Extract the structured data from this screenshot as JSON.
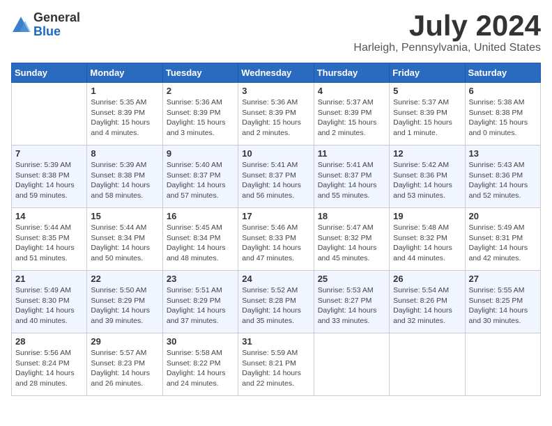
{
  "header": {
    "logo_general": "General",
    "logo_blue": "Blue",
    "month_title": "July 2024",
    "location": "Harleigh, Pennsylvania, United States"
  },
  "days_of_week": [
    "Sunday",
    "Monday",
    "Tuesday",
    "Wednesday",
    "Thursday",
    "Friday",
    "Saturday"
  ],
  "weeks": [
    [
      {
        "day": "",
        "info": ""
      },
      {
        "day": "1",
        "info": "Sunrise: 5:35 AM\nSunset: 8:39 PM\nDaylight: 15 hours\nand 4 minutes."
      },
      {
        "day": "2",
        "info": "Sunrise: 5:36 AM\nSunset: 8:39 PM\nDaylight: 15 hours\nand 3 minutes."
      },
      {
        "day": "3",
        "info": "Sunrise: 5:36 AM\nSunset: 8:39 PM\nDaylight: 15 hours\nand 2 minutes."
      },
      {
        "day": "4",
        "info": "Sunrise: 5:37 AM\nSunset: 8:39 PM\nDaylight: 15 hours\nand 2 minutes."
      },
      {
        "day": "5",
        "info": "Sunrise: 5:37 AM\nSunset: 8:39 PM\nDaylight: 15 hours\nand 1 minute."
      },
      {
        "day": "6",
        "info": "Sunrise: 5:38 AM\nSunset: 8:38 PM\nDaylight: 15 hours\nand 0 minutes."
      }
    ],
    [
      {
        "day": "7",
        "info": "Sunrise: 5:39 AM\nSunset: 8:38 PM\nDaylight: 14 hours\nand 59 minutes."
      },
      {
        "day": "8",
        "info": "Sunrise: 5:39 AM\nSunset: 8:38 PM\nDaylight: 14 hours\nand 58 minutes."
      },
      {
        "day": "9",
        "info": "Sunrise: 5:40 AM\nSunset: 8:37 PM\nDaylight: 14 hours\nand 57 minutes."
      },
      {
        "day": "10",
        "info": "Sunrise: 5:41 AM\nSunset: 8:37 PM\nDaylight: 14 hours\nand 56 minutes."
      },
      {
        "day": "11",
        "info": "Sunrise: 5:41 AM\nSunset: 8:37 PM\nDaylight: 14 hours\nand 55 minutes."
      },
      {
        "day": "12",
        "info": "Sunrise: 5:42 AM\nSunset: 8:36 PM\nDaylight: 14 hours\nand 53 minutes."
      },
      {
        "day": "13",
        "info": "Sunrise: 5:43 AM\nSunset: 8:36 PM\nDaylight: 14 hours\nand 52 minutes."
      }
    ],
    [
      {
        "day": "14",
        "info": "Sunrise: 5:44 AM\nSunset: 8:35 PM\nDaylight: 14 hours\nand 51 minutes."
      },
      {
        "day": "15",
        "info": "Sunrise: 5:44 AM\nSunset: 8:34 PM\nDaylight: 14 hours\nand 50 minutes."
      },
      {
        "day": "16",
        "info": "Sunrise: 5:45 AM\nSunset: 8:34 PM\nDaylight: 14 hours\nand 48 minutes."
      },
      {
        "day": "17",
        "info": "Sunrise: 5:46 AM\nSunset: 8:33 PM\nDaylight: 14 hours\nand 47 minutes."
      },
      {
        "day": "18",
        "info": "Sunrise: 5:47 AM\nSunset: 8:32 PM\nDaylight: 14 hours\nand 45 minutes."
      },
      {
        "day": "19",
        "info": "Sunrise: 5:48 AM\nSunset: 8:32 PM\nDaylight: 14 hours\nand 44 minutes."
      },
      {
        "day": "20",
        "info": "Sunrise: 5:49 AM\nSunset: 8:31 PM\nDaylight: 14 hours\nand 42 minutes."
      }
    ],
    [
      {
        "day": "21",
        "info": "Sunrise: 5:49 AM\nSunset: 8:30 PM\nDaylight: 14 hours\nand 40 minutes."
      },
      {
        "day": "22",
        "info": "Sunrise: 5:50 AM\nSunset: 8:29 PM\nDaylight: 14 hours\nand 39 minutes."
      },
      {
        "day": "23",
        "info": "Sunrise: 5:51 AM\nSunset: 8:29 PM\nDaylight: 14 hours\nand 37 minutes."
      },
      {
        "day": "24",
        "info": "Sunrise: 5:52 AM\nSunset: 8:28 PM\nDaylight: 14 hours\nand 35 minutes."
      },
      {
        "day": "25",
        "info": "Sunrise: 5:53 AM\nSunset: 8:27 PM\nDaylight: 14 hours\nand 33 minutes."
      },
      {
        "day": "26",
        "info": "Sunrise: 5:54 AM\nSunset: 8:26 PM\nDaylight: 14 hours\nand 32 minutes."
      },
      {
        "day": "27",
        "info": "Sunrise: 5:55 AM\nSunset: 8:25 PM\nDaylight: 14 hours\nand 30 minutes."
      }
    ],
    [
      {
        "day": "28",
        "info": "Sunrise: 5:56 AM\nSunset: 8:24 PM\nDaylight: 14 hours\nand 28 minutes."
      },
      {
        "day": "29",
        "info": "Sunrise: 5:57 AM\nSunset: 8:23 PM\nDaylight: 14 hours\nand 26 minutes."
      },
      {
        "day": "30",
        "info": "Sunrise: 5:58 AM\nSunset: 8:22 PM\nDaylight: 14 hours\nand 24 minutes."
      },
      {
        "day": "31",
        "info": "Sunrise: 5:59 AM\nSunset: 8:21 PM\nDaylight: 14 hours\nand 22 minutes."
      },
      {
        "day": "",
        "info": ""
      },
      {
        "day": "",
        "info": ""
      },
      {
        "day": "",
        "info": ""
      }
    ]
  ]
}
